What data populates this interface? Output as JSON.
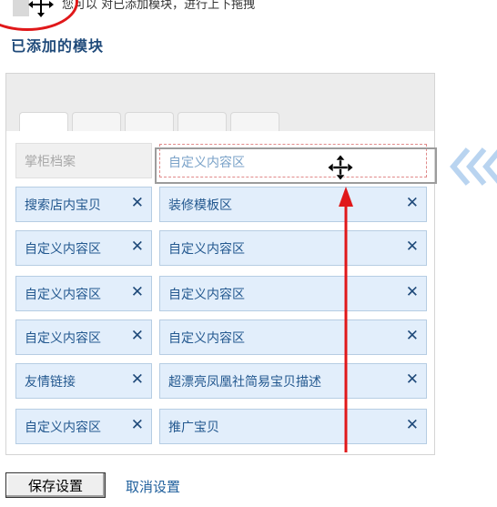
{
  "hint": {
    "text": "您可以 对已添加模块，进行上下拖拽"
  },
  "section": {
    "title": "已添加的模块"
  },
  "modules": {
    "static": "掌柜档案",
    "dragging": "自定义内容区",
    "left_column": [
      "搜索店内宝贝",
      "自定义内容区",
      "自定义内容区",
      "自定义内容区",
      "友情链接",
      "自定义内容区"
    ],
    "right_column": [
      "装修模板区",
      "自定义内容区",
      "自定义内容区",
      "自定义内容区",
      "超漂亮凤凰社简易宝贝描述",
      "推广宝贝"
    ],
    "remove_glyph": "✕"
  },
  "actions": {
    "save_label": "保存设置",
    "cancel_label": "取消设置"
  },
  "colors": {
    "slot_bg": "#e2eefb",
    "slot_border": "#b6cde3",
    "title_text": "#1f4a7a",
    "annotation_red": "#e0181a",
    "chevron_blue": "#b9d4f0"
  },
  "icons": [
    "move-icon",
    "remove-icon",
    "chevron-left-icon",
    "arrow-up-icon"
  ]
}
